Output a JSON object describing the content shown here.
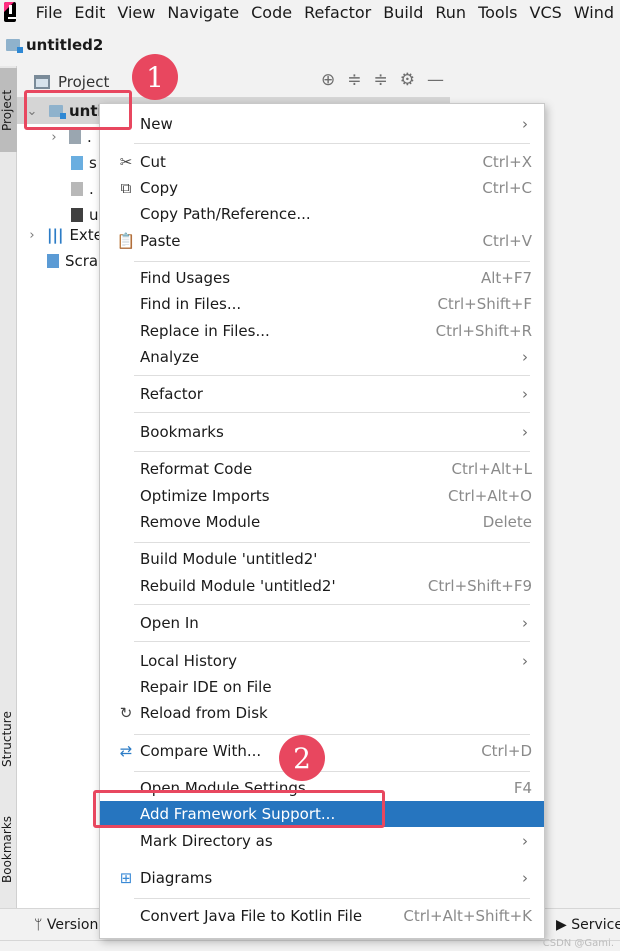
{
  "menubar": [
    "File",
    "Edit",
    "View",
    "Navigate",
    "Code",
    "Refactor",
    "Build",
    "Run",
    "Tools",
    "VCS",
    "Wind"
  ],
  "project_title": "untitled2",
  "toolstrip": {
    "project": "Project",
    "structure": "Structure",
    "bookmarks": "Bookmarks"
  },
  "panel": {
    "title": "Project"
  },
  "tree": {
    "root": "unti",
    "child1": ".",
    "child2": "s",
    "child3": ".",
    "child4": "u",
    "external": "Exte",
    "scratches": "Scra"
  },
  "bottom": {
    "version": "Version",
    "services": "Service"
  },
  "menu": [
    {
      "label": "New",
      "shortcut": "",
      "submenu": true,
      "icon": ""
    },
    {
      "label": "Cut",
      "shortcut": "Ctrl+X",
      "icon": "scissors-icon"
    },
    {
      "label": "Copy",
      "shortcut": "Ctrl+C",
      "icon": "copy-icon"
    },
    {
      "label": "Copy Path/Reference...",
      "shortcut": ""
    },
    {
      "label": "Paste",
      "shortcut": "Ctrl+V",
      "icon": "clipboard-icon"
    },
    {
      "label": "Find Usages",
      "shortcut": "Alt+F7"
    },
    {
      "label": "Find in Files...",
      "shortcut": "Ctrl+Shift+F"
    },
    {
      "label": "Replace in Files...",
      "shortcut": "Ctrl+Shift+R"
    },
    {
      "label": "Analyze",
      "shortcut": "",
      "submenu": true
    },
    {
      "label": "Refactor",
      "shortcut": "",
      "submenu": true
    },
    {
      "label": "Bookmarks",
      "shortcut": "",
      "submenu": true
    },
    {
      "label": "Reformat Code",
      "shortcut": "Ctrl+Alt+L"
    },
    {
      "label": "Optimize Imports",
      "shortcut": "Ctrl+Alt+O"
    },
    {
      "label": "Remove Module",
      "shortcut": "Delete"
    },
    {
      "label": "Build Module 'untitled2'",
      "shortcut": ""
    },
    {
      "label": "Rebuild Module 'untitled2'",
      "shortcut": "Ctrl+Shift+F9"
    },
    {
      "label": "Open In",
      "shortcut": "",
      "submenu": true
    },
    {
      "label": "Local History",
      "shortcut": "",
      "submenu": true
    },
    {
      "label": "Repair IDE on File",
      "shortcut": ""
    },
    {
      "label": "Reload from Disk",
      "shortcut": "",
      "icon": "reload-icon"
    },
    {
      "label": "Compare With...",
      "shortcut": "Ctrl+D",
      "icon": "compare-icon"
    },
    {
      "label": "Open Module Settings",
      "shortcut": "F4"
    },
    {
      "label": "Add Framework Support...",
      "shortcut": "",
      "highlighted": true
    },
    {
      "label": "Mark Directory as",
      "shortcut": "",
      "submenu": true
    },
    {
      "label": "Diagrams",
      "shortcut": "",
      "submenu": true,
      "icon": "diagram-icon"
    },
    {
      "label": "Convert Java File to Kotlin File",
      "shortcut": "Ctrl+Alt+Shift+K"
    }
  ],
  "annotations": {
    "badge1": "1",
    "badge2": "2"
  },
  "watermark": "CSDN @Gami.",
  "colors": {
    "highlight": "#2675bf",
    "annotation": "#e8475f"
  }
}
